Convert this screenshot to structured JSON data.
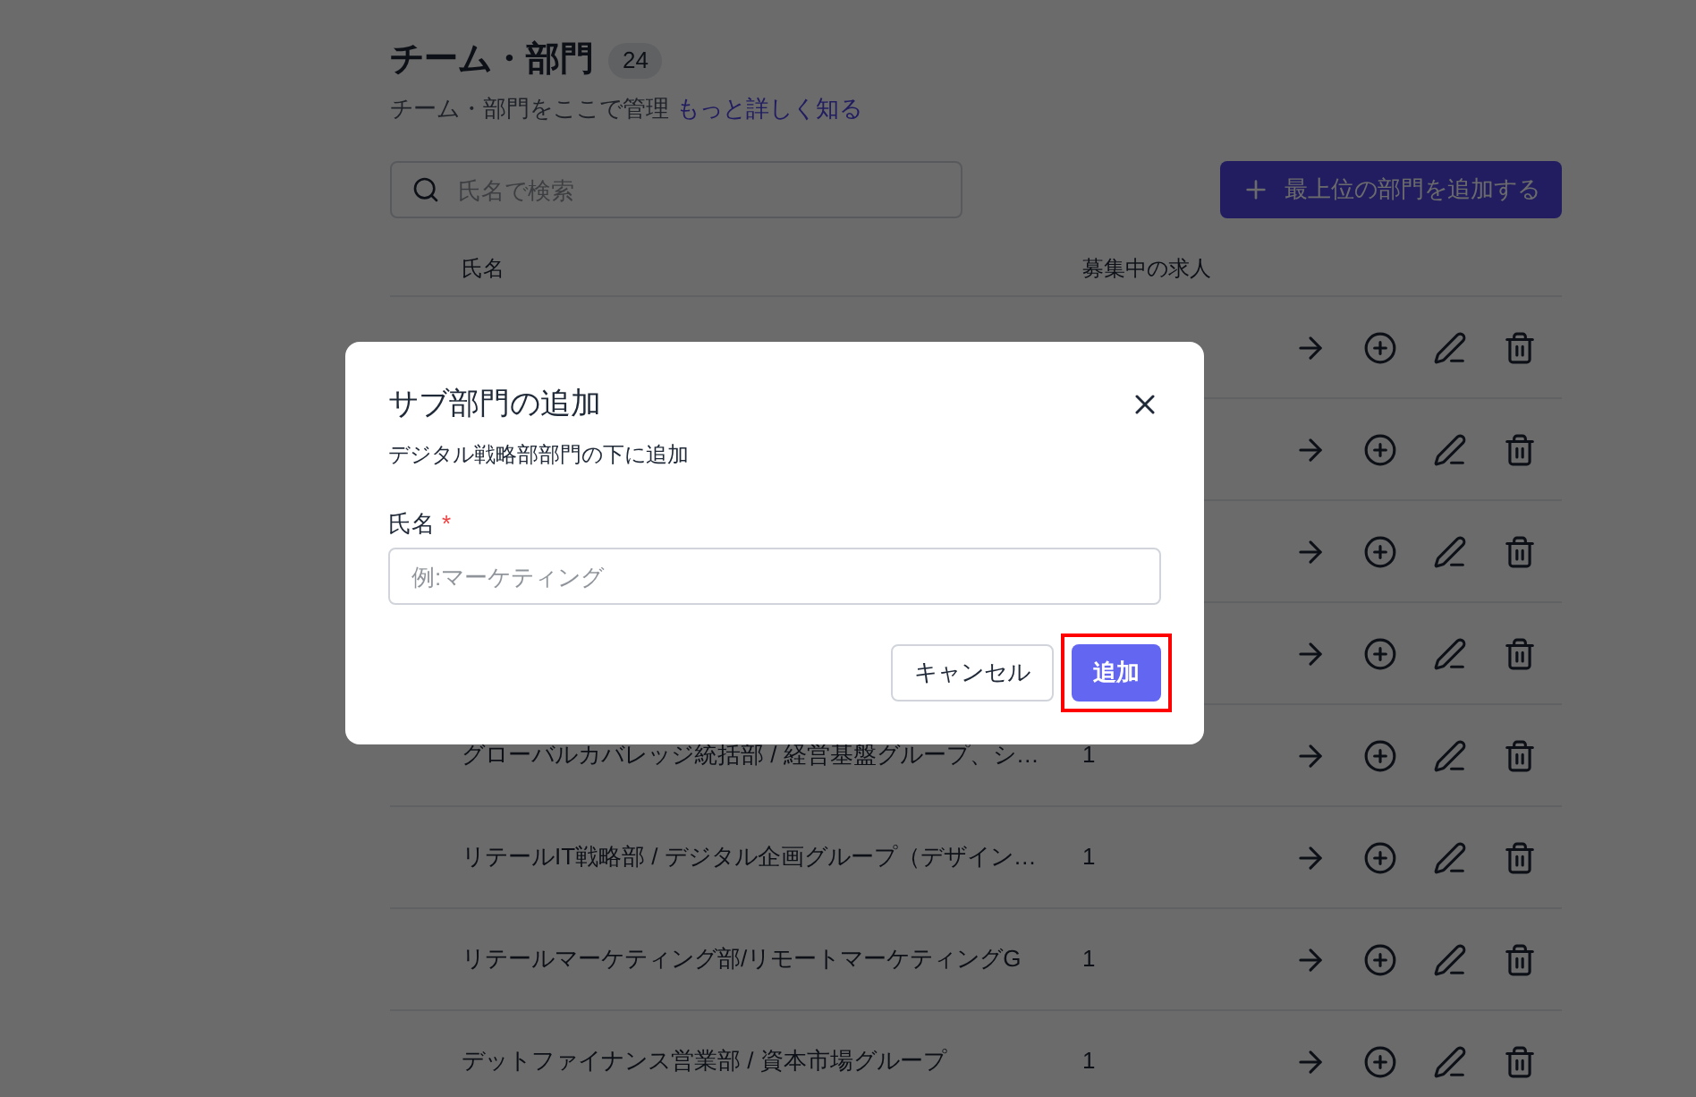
{
  "page": {
    "title": "チーム・部門",
    "count": "24",
    "subtitle": "チーム・部門をここで管理",
    "learn_more_link": "もっと詳しく知る"
  },
  "search": {
    "placeholder": "氏名で検索"
  },
  "add_top_button": "最上位の部門を追加する",
  "table": {
    "columns": [
      "氏名",
      "募集中の求人"
    ],
    "rows": [
      {},
      {},
      {},
      {},
      {
        "name": "グローバルカバレッジ統括部 / 経営基盤グループ、シ…",
        "openings": "1"
      },
      {
        "name": "リテールIT戦略部 / デジタル企画グループ（デザイン…",
        "openings": "1"
      },
      {
        "name": "リテールマーケティング部/リモートマーケティングG",
        "openings": "1"
      },
      {
        "name": "デットファイナンス営業部 / 資本市場グループ",
        "openings": "1"
      }
    ]
  },
  "dialog": {
    "title": "サブ部門の追加",
    "subtitle": "デジタル戦略部部門の下に追加",
    "field_label": "氏名",
    "required_mark": "*",
    "placeholder": "例:マーケティング",
    "cancel_button": "キャンセル",
    "submit_button": "追加",
    "submit_highlighted": true
  }
}
